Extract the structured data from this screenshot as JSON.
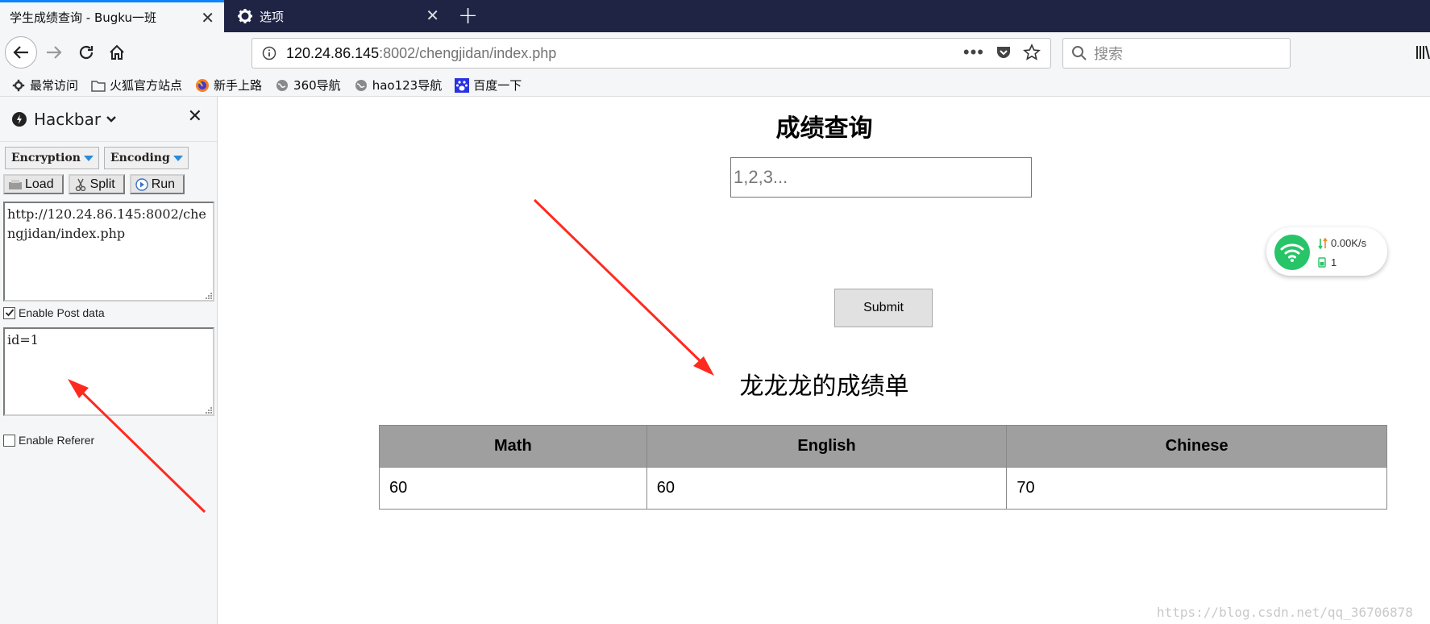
{
  "browser": {
    "tabs": [
      {
        "title": "学生成绩查询 - Bugku一班",
        "active": true
      },
      {
        "title": "选项",
        "active": false
      }
    ],
    "url": {
      "host": "120.24.86.145",
      "rest": ":8002/chengjidan/index.php"
    },
    "search_placeholder": "搜索",
    "bookmarks": [
      {
        "label": "最常访问",
        "icon": "gear-icon"
      },
      {
        "label": "火狐官方站点",
        "icon": "folder-icon"
      },
      {
        "label": "新手上路",
        "icon": "firefox-icon"
      },
      {
        "label": "360导航",
        "icon": "globe-icon"
      },
      {
        "label": "hao123导航",
        "icon": "globe-icon"
      },
      {
        "label": "百度一下",
        "icon": "baidu-paw-icon"
      }
    ]
  },
  "hackbar": {
    "title": "Hackbar",
    "encryption_label": "Encryption",
    "encoding_label": "Encoding",
    "load_label": "Load",
    "split_label": "Split",
    "run_label": "Run",
    "url_text": "http://120.24.86.145:8002/chengjidan/index.php",
    "enable_post_label": "Enable Post data",
    "enable_post_checked": true,
    "post_data": "id=1",
    "enable_referer_label": "Enable Referer",
    "enable_referer_checked": false
  },
  "page": {
    "title": "成绩查询",
    "input_placeholder": "1,2,3...",
    "submit_label": "Submit",
    "report_title": "龙龙龙的成绩单",
    "table": {
      "headers": [
        "Math",
        "English",
        "Chinese"
      ],
      "rows": [
        [
          "60",
          "60",
          "70"
        ]
      ]
    }
  },
  "net_widget": {
    "speed": "0.00K/s",
    "count": "1",
    "accent": "#28c468"
  },
  "watermark": "https://blog.csdn.net/qq_36706878",
  "colors": {
    "tab_accent": "#0a84ff",
    "tabbar_bg": "#1f2444",
    "arrow": "#ff2a1f",
    "table_header": "#9f9f9f"
  }
}
